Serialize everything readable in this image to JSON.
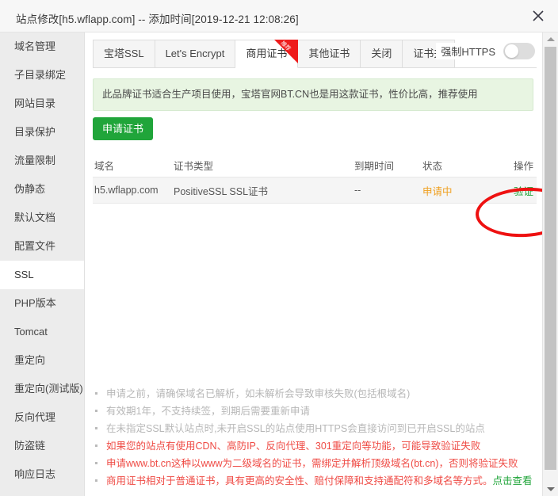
{
  "window": {
    "title": "站点修改[h5.wflapp.com] -- 添加时间[2019-12-21 12:08:26]",
    "close_icon": "close-icon"
  },
  "sidebar": {
    "items": [
      {
        "label": "域名管理",
        "active": false
      },
      {
        "label": "子目录绑定",
        "active": false
      },
      {
        "label": "网站目录",
        "active": false
      },
      {
        "label": "目录保护",
        "active": false
      },
      {
        "label": "流量限制",
        "active": false
      },
      {
        "label": "伪静态",
        "active": false
      },
      {
        "label": "默认文档",
        "active": false
      },
      {
        "label": "配置文件",
        "active": false
      },
      {
        "label": "SSL",
        "active": true
      },
      {
        "label": "PHP版本",
        "active": false
      },
      {
        "label": "Tomcat",
        "active": false
      },
      {
        "label": "重定向",
        "active": false
      },
      {
        "label": "重定向(测试版)",
        "active": false
      },
      {
        "label": "反向代理",
        "active": false
      },
      {
        "label": "防盗链",
        "active": false
      },
      {
        "label": "响应日志",
        "active": false
      }
    ]
  },
  "tabs": [
    {
      "label": "宝塔SSL",
      "active": false,
      "ribbon": ""
    },
    {
      "label": "Let's Encrypt",
      "active": false,
      "ribbon": ""
    },
    {
      "label": "商用证书",
      "active": true,
      "ribbon": "推荐"
    },
    {
      "label": "其他证书",
      "active": false,
      "ribbon": ""
    },
    {
      "label": "关闭",
      "active": false,
      "ribbon": ""
    },
    {
      "label": "证书夹",
      "active": false,
      "ribbon": ""
    }
  ],
  "force_https": {
    "label": "强制HTTPS",
    "enabled": false
  },
  "banner": {
    "text": "此品牌证书适合生产项目使用，宝塔官网BT.CN也是用这款证书，性价比高，推荐使用"
  },
  "apply_button": {
    "label": "申请证书"
  },
  "table": {
    "headers": {
      "domain": "域名",
      "type": "证书类型",
      "expire": "到期时间",
      "status": "状态",
      "op": "操作"
    },
    "rows": [
      {
        "domain": "h5.wflapp.com",
        "type": "PositiveSSL SSL证书",
        "expire": "--",
        "status": "申请中",
        "op": "验证"
      }
    ]
  },
  "notes": [
    {
      "text": "申请之前，请确保域名已解析，如未解析会导致审核失败(包括根域名)",
      "color": "gray"
    },
    {
      "text": "有效期1年，不支持续签，到期后需要重新申请",
      "color": "gray"
    },
    {
      "text": "在未指定SSL默认站点时,未开启SSL的站点使用HTTPS会直接访问到已开启SSL的站点",
      "color": "gray"
    },
    {
      "text": "如果您的站点有使用CDN、高防IP、反向代理、301重定向等功能，可能导致验证失败",
      "color": "red"
    },
    {
      "text": "申请www.bt.cn这种以www为二级域名的证书，需绑定并解析顶级域名(bt.cn)，否则将验证失败",
      "color": "red"
    },
    {
      "text": "商用证书相对于普通证书，具有更高的安全性、赔付保障和支持通配符和多域名等方式。",
      "color": "red",
      "link": "点击查看"
    }
  ],
  "colors": {
    "accent_green": "#20a53a",
    "warning_orange": "#f0a020",
    "danger_red": "#ef4b45",
    "annotation_red": "#ee1111",
    "sidebar_bg": "#ececec"
  }
}
